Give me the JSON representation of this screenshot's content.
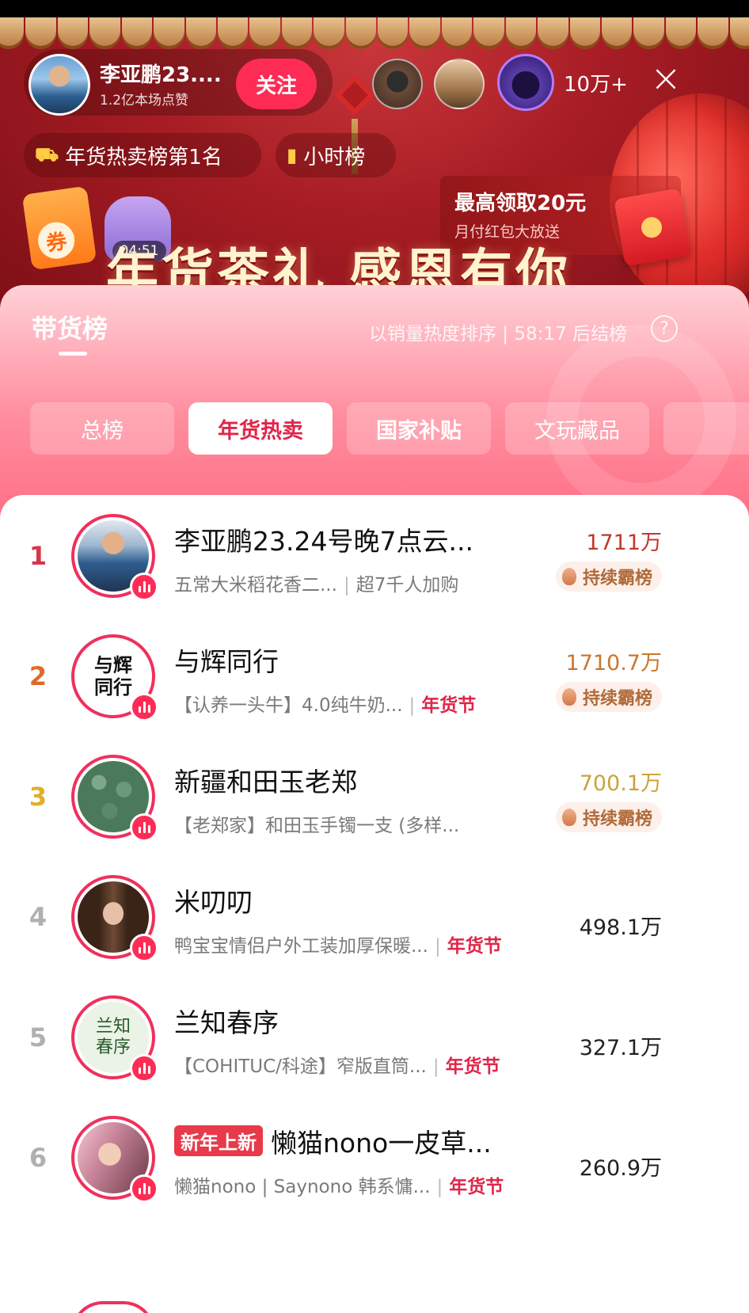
{
  "header": {
    "host_name": "李亚鹏23....",
    "host_likes": "1.2亿本场点赞",
    "follow_label": "关注",
    "viewer_count": "10万+",
    "close_icon": "×"
  },
  "pills": {
    "rank_label": "年货热卖榜第1名",
    "hour_label": "小时榜"
  },
  "promo": {
    "title": "最高领取20元",
    "subtitle": "月付红包大放送",
    "timer": "04:51",
    "coupon_char": "券",
    "slogan": "年货茶礼 感恩有你"
  },
  "board": {
    "title": "带货榜",
    "meta": "以销量热度排序 | 58:17 后结榜",
    "help": "?",
    "tabs": [
      "总榜",
      "年货热卖",
      "国家补贴",
      "文玩藏品",
      ""
    ],
    "active_tab": "年货热卖"
  },
  "rows": [
    {
      "rank": "1",
      "rank_color": "#d8364a",
      "name": "李亚鹏23.24号晚7点云...",
      "desc": "五常大米稻花香二...",
      "extra": "超7千人加购",
      "tag": "",
      "score": "1711万",
      "score_color": "#c0392b",
      "badge": "持续霸榜",
      "new_tag": ""
    },
    {
      "rank": "2",
      "rank_color": "#e06a2a",
      "name": "与辉同行",
      "desc": "【认养一头牛】4.0纯牛奶...",
      "extra": "",
      "tag": "年货节",
      "score": "1710.7万",
      "score_color": "#c8772e",
      "badge": "持续霸榜",
      "new_tag": ""
    },
    {
      "rank": "3",
      "rank_color": "#e0b02a",
      "name": "新疆和田玉老郑",
      "desc": "【老郑家】和田玉手镯一支 (多样...",
      "extra": "",
      "tag": "",
      "score": "700.1万",
      "score_color": "#c9a43a",
      "badge": "持续霸榜",
      "new_tag": ""
    },
    {
      "rank": "4",
      "rank_color": "#b0b0b0",
      "name": "米叨叨",
      "desc": "鸭宝宝情侣户外工装加厚保暖...",
      "extra": "",
      "tag": "年货节",
      "score": "498.1万",
      "score_color": "#222",
      "badge": "",
      "new_tag": ""
    },
    {
      "rank": "5",
      "rank_color": "#b0b0b0",
      "name": "兰知春序",
      "desc": "【COHITUC/科途】窄版直筒...",
      "extra": "",
      "tag": "年货节",
      "score": "327.1万",
      "score_color": "#222",
      "badge": "",
      "new_tag": ""
    },
    {
      "rank": "6",
      "rank_color": "#b0b0b0",
      "name": "懒猫nono一皮草...",
      "desc": "懒猫nono | Saynono 韩系慵...",
      "extra": "",
      "tag": "年货节",
      "score": "260.9万",
      "score_color": "#222",
      "badge": "",
      "new_tag": "新年上新"
    }
  ],
  "avatars": {
    "row2_text": "与辉同行",
    "row5_text": "兰知春序"
  },
  "colors": {
    "accent": "#fe2c55",
    "banner_red": "#a61c24",
    "tag_red": "#e0254a"
  }
}
